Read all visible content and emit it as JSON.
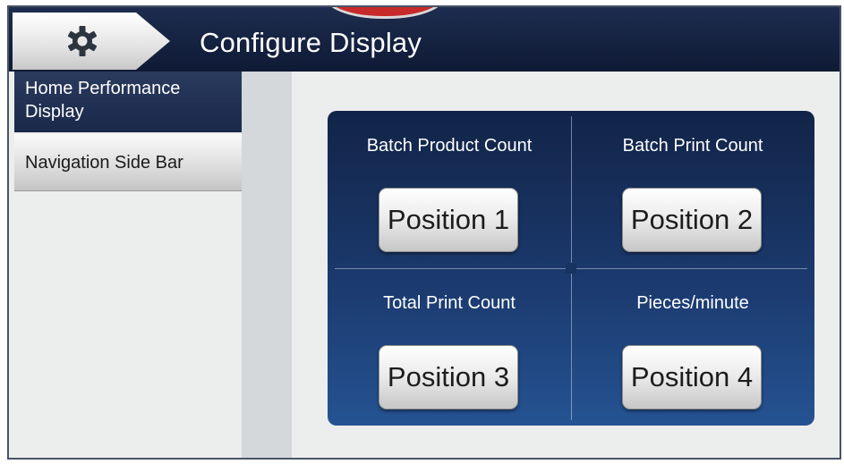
{
  "header": {
    "title": "Configure Display",
    "home_icon": "gear-icon"
  },
  "sidebar": {
    "items": [
      {
        "label": "Home Performance Display",
        "active": true
      },
      {
        "label": "Navigation Side Bar",
        "active": false
      }
    ]
  },
  "positions": [
    {
      "label": "Batch Product Count",
      "button": "Position 1"
    },
    {
      "label": "Batch Print Count",
      "button": "Position 2"
    },
    {
      "label": "Total Print Count",
      "button": "Position 3"
    },
    {
      "label": "Pieces/minute",
      "button": "Position 4"
    }
  ],
  "colors": {
    "header_bg": "#14213f",
    "panel_bg": "#1b3a6e",
    "active_item_bg": "#1a2849",
    "badge_red": "#c62a2a"
  }
}
